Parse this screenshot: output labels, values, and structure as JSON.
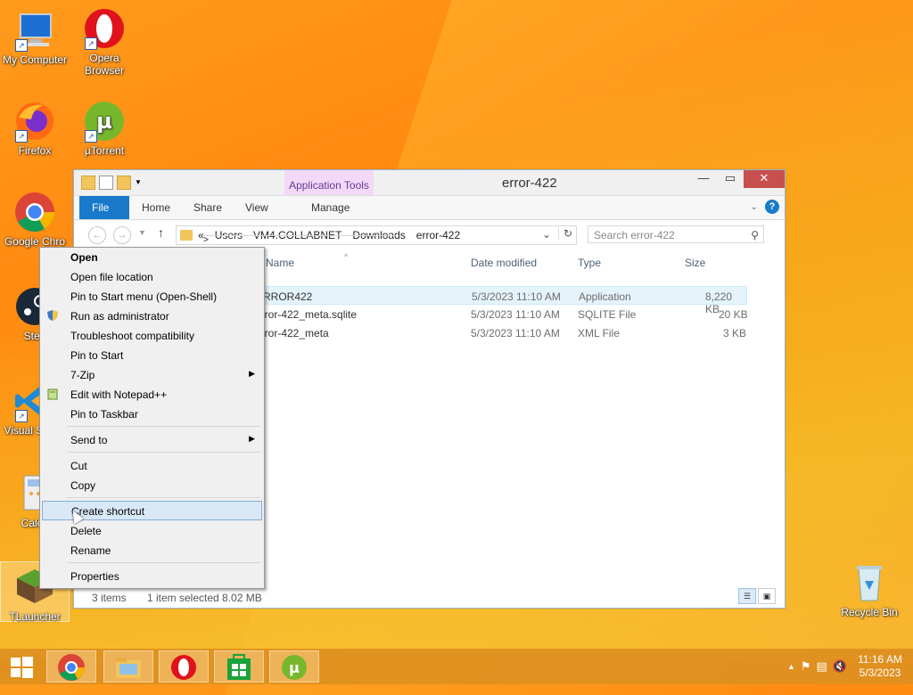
{
  "desktop": {
    "icons": [
      {
        "label": "My Computer"
      },
      {
        "label": "Opera Browser"
      },
      {
        "label": "Firefox"
      },
      {
        "label": "µTorrent"
      },
      {
        "label": "Google Chro"
      },
      {
        "label": "Stea"
      },
      {
        "label": "Visual S Coo"
      },
      {
        "label": "Calcu"
      },
      {
        "label": "TLauncher"
      },
      {
        "label": "Recycle Bin"
      }
    ]
  },
  "window": {
    "title": "error-422",
    "contextual_tab": "Application Tools",
    "ribbon_tabs": [
      "File",
      "Home",
      "Share",
      "View",
      "Manage"
    ],
    "address": {
      "overflow": "«",
      "crumbs": [
        "Users",
        "VM4.COLLABNET",
        "Downloads",
        "error-422"
      ]
    },
    "search_placeholder": "Search error-422",
    "columns": {
      "name": "Name",
      "date": "Date modified",
      "type": "Type",
      "size": "Size"
    },
    "files": [
      {
        "name": "ERROR422",
        "date": "5/3/2023 11:10 AM",
        "type": "Application",
        "size": "8,220 KB"
      },
      {
        "name": "error-422_meta.sqlite",
        "date": "5/3/2023 11:10 AM",
        "type": "SQLITE File",
        "size": "20 KB"
      },
      {
        "name": "error-422_meta",
        "date": "5/3/2023 11:10 AM",
        "type": "XML File",
        "size": "3 KB"
      }
    ],
    "status": {
      "items": "3 items",
      "selected": "1 item selected  8.02 MB"
    }
  },
  "context_menu": {
    "items": [
      {
        "label": "Open"
      },
      {
        "label": "Open file location"
      },
      {
        "label": "Pin to Start menu (Open-Shell)"
      },
      {
        "label": "Run as administrator"
      },
      {
        "label": "Troubleshoot compatibility"
      },
      {
        "label": "Pin to Start"
      },
      {
        "label": "7-Zip"
      },
      {
        "label": "Edit with Notepad++"
      },
      {
        "label": "Pin to Taskbar"
      },
      {
        "label": "Send to"
      },
      {
        "label": "Cut"
      },
      {
        "label": "Copy"
      },
      {
        "label": "Create shortcut"
      },
      {
        "label": "Delete"
      },
      {
        "label": "Rename"
      },
      {
        "label": "Properties"
      }
    ]
  },
  "taskbar": {
    "clock_time": "11:16 AM",
    "clock_date": "5/3/2023"
  },
  "colors": {
    "accent": "#1979ca",
    "close_button": "#c7504f",
    "highlight": "#d9e8f7"
  }
}
